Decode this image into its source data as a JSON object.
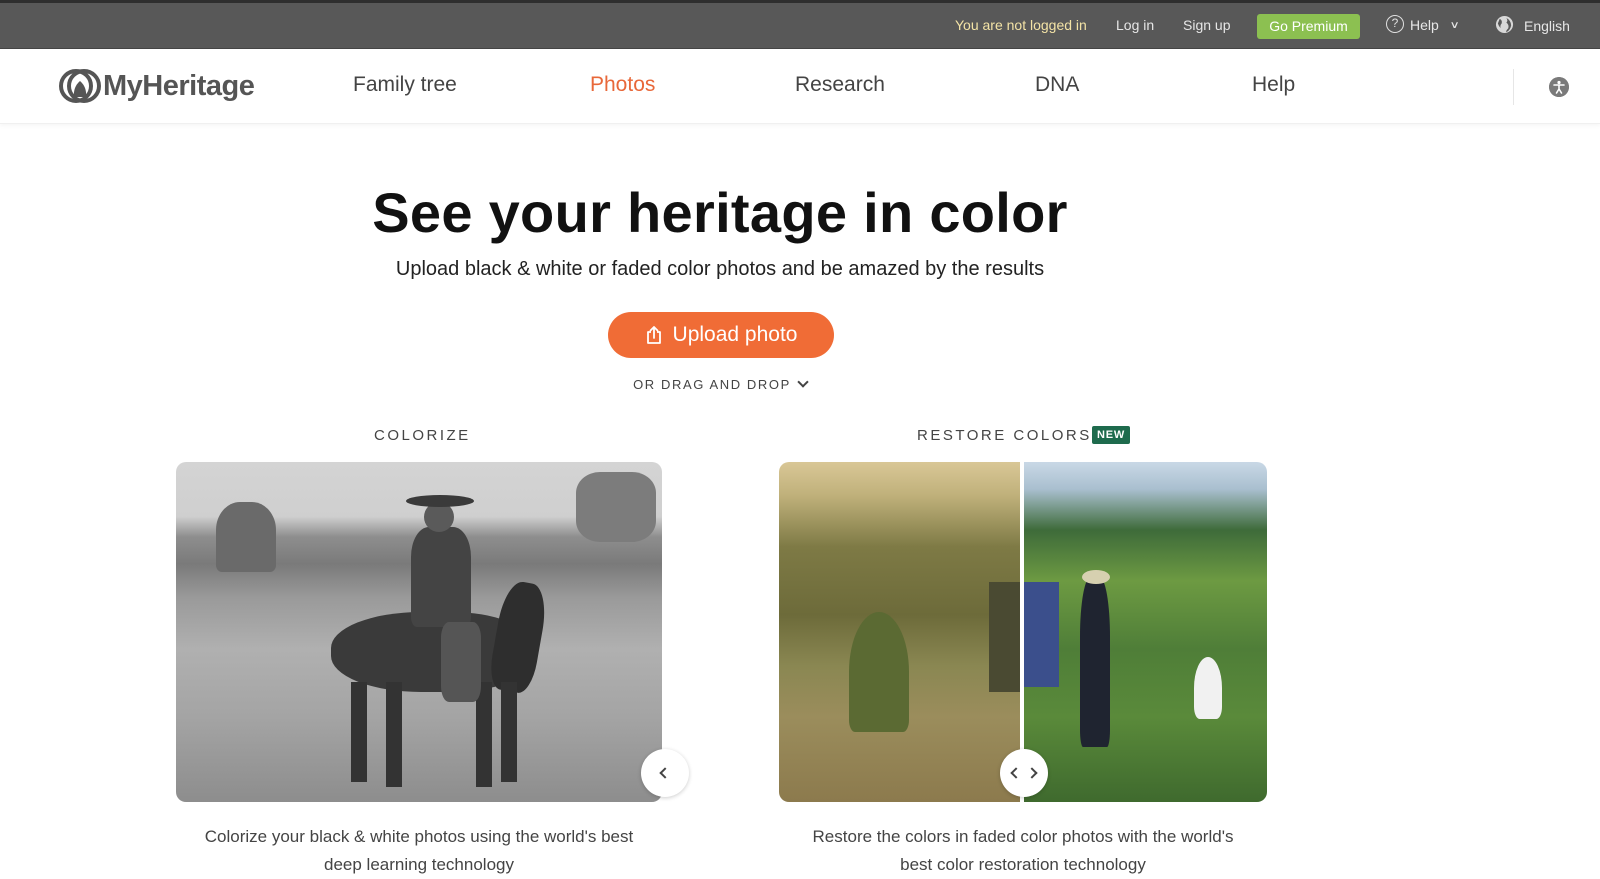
{
  "topbar": {
    "status": "You are not logged in",
    "login": "Log in",
    "signup": "Sign up",
    "premium": "Go Premium",
    "help": "Help",
    "language": "English"
  },
  "nav": {
    "brand": "MyHeritage",
    "links": [
      {
        "label": "Family tree",
        "active": false
      },
      {
        "label": "Photos",
        "active": true
      },
      {
        "label": "Research",
        "active": false
      },
      {
        "label": "DNA",
        "active": false
      },
      {
        "label": "Help",
        "active": false
      }
    ]
  },
  "hero": {
    "title": "See your heritage in color",
    "subtitle": "Upload black & white or faded color photos and be amazed by the results",
    "upload_label": "Upload photo",
    "drag_label": "OR DRAG AND DROP"
  },
  "sections": {
    "colorize": {
      "label": "COLORIZE",
      "caption_line1": "Colorize your black & white photos using the world's best",
      "caption_line2": "deep learning technology"
    },
    "restore": {
      "label": "RESTORE COLORS",
      "badge": "NEW",
      "caption_line1": "Restore the colors in faded color photos with the world's",
      "caption_line2": "best color restoration technology"
    }
  },
  "colors": {
    "accent": "#f06c36",
    "premium": "#8cc051",
    "badge": "#1e6b4d",
    "topbar": "#585858"
  }
}
